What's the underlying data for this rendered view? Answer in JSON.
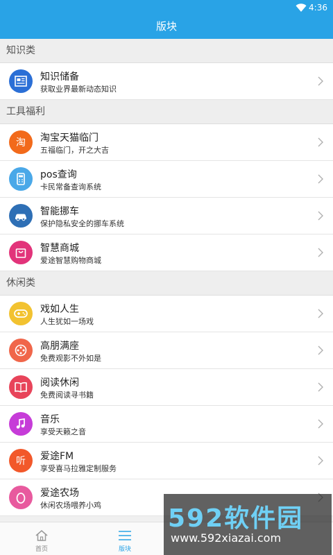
{
  "status": {
    "time": "4:36"
  },
  "header": {
    "title": "版块"
  },
  "colors": {
    "accent": "#29a3e6"
  },
  "sections": [
    {
      "title": "知识类",
      "items": [
        {
          "title": "知识储备",
          "subtitle": "获取业界最新动态知识",
          "icon": "newspaper-icon",
          "color": "#2b6fd6"
        }
      ]
    },
    {
      "title": "工具福利",
      "items": [
        {
          "title": "淘宝天猫临门",
          "subtitle": "五福临门，开之大吉",
          "icon": "taobao-icon",
          "color": "#f26a1b"
        },
        {
          "title": "pos查询",
          "subtitle": "卡民常备查询系统",
          "icon": "pos-terminal-icon",
          "color": "#4aa8e8"
        },
        {
          "title": "智能挪车",
          "subtitle": "保护隐私安全的挪车系统",
          "icon": "car-icon",
          "color": "#2e6fb5"
        },
        {
          "title": "智慧商城",
          "subtitle": "爱途智慧购物商城",
          "icon": "shopping-bag-icon",
          "color": "#e2337a"
        }
      ]
    },
    {
      "title": "休闲类",
      "items": [
        {
          "title": "戏如人生",
          "subtitle": "人生犹如一场戏",
          "icon": "gamepad-icon",
          "color": "#f2c230"
        },
        {
          "title": "高朋满座",
          "subtitle": "免费观影不外如是",
          "icon": "film-reel-icon",
          "color": "#f0664a"
        },
        {
          "title": "阅读休闲",
          "subtitle": "免费阅读寻书籍",
          "icon": "book-icon",
          "color": "#e8445a"
        },
        {
          "title": "音乐",
          "subtitle": "享受天籁之音",
          "icon": "music-note-icon",
          "color": "#c63cd8"
        },
        {
          "title": "爱途FM",
          "subtitle": "享受喜马拉雅定制服务",
          "icon": "fm-radio-icon",
          "color": "#f2582a"
        },
        {
          "title": "爱途农场",
          "subtitle": "休闲农场喂养小鸡",
          "icon": "egg-icon",
          "color": "#e85a9e"
        }
      ]
    }
  ],
  "tabs": [
    {
      "label": "首页",
      "icon": "home-icon",
      "active": false
    },
    {
      "label": "版块",
      "icon": "menu-icon",
      "active": true
    }
  ],
  "watermark": {
    "brand": "592软件园",
    "url": "www.592xiazai.com"
  }
}
